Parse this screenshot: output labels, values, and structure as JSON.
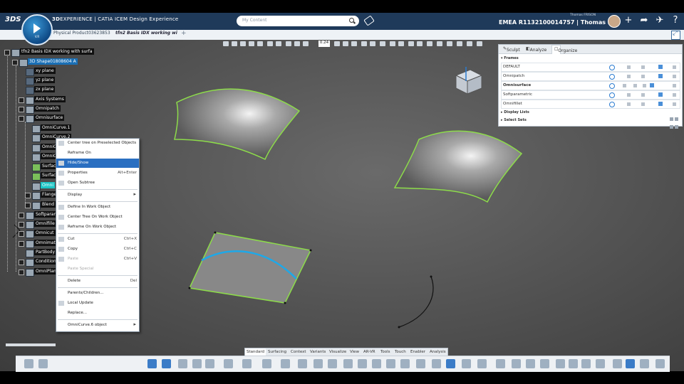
{
  "topbar": {
    "brand_bold": "3D",
    "brand_rest": "EXPERIENCE | CATIA",
    "brand_app": "ICEM Design Experience",
    "compass_label": "V.R",
    "search_placeholder": "My Content",
    "tenant": "EMEA R1132100014757 | Thomas ...",
    "user_name": "Thomas FRISON",
    "icons": [
      "ds-logo-icon",
      "search-icon",
      "tag-icon",
      "avatar",
      "plus-icon",
      "share-icon",
      "broadcast-icon",
      "help-icon"
    ]
  },
  "tabs": [
    {
      "label": "Physical Product03623853",
      "active": false
    },
    {
      "label": "tfn2 Basis IDX working wi",
      "active": true
    }
  ],
  "tree": {
    "items": [
      {
        "label": "tfn2 Basis IDX working with surfa",
        "style": "plain"
      },
      {
        "label": "3D Shape01808604 A",
        "style": "sel"
      },
      {
        "label": "xy plane",
        "style": "plain"
      },
      {
        "label": "yz plane",
        "style": "plain"
      },
      {
        "label": "zx plane",
        "style": "plain"
      },
      {
        "label": "Axis Systems",
        "style": "plain"
      },
      {
        "label": "Omnipatch",
        "style": "plain"
      },
      {
        "label": "Omnisurface",
        "style": "plain"
      },
      {
        "label": "OmniCurve.1",
        "style": "plain"
      },
      {
        "label": "OmniCurve.2",
        "style": "plain"
      },
      {
        "label": "OmniCurve.1",
        "style": "plain"
      },
      {
        "label": "OmniCurve.2",
        "style": "plain"
      },
      {
        "label": "Surface.13",
        "style": "plain"
      },
      {
        "label": "Surface.13",
        "style": "plain"
      },
      {
        "label": "Omni",
        "style": "hl"
      },
      {
        "label": "Flange",
        "style": "plain"
      },
      {
        "label": "Blend",
        "style": "plain"
      },
      {
        "label": "Softparam",
        "style": "plain"
      },
      {
        "label": "Omnifille",
        "style": "plain"
      },
      {
        "label": "Omnicut",
        "style": "plain"
      },
      {
        "label": "Omnimat",
        "style": "plain"
      },
      {
        "label": "PartBody",
        "style": "plain"
      },
      {
        "label": "Condition",
        "style": "plain"
      },
      {
        "label": "OmniPlan",
        "style": "plain"
      }
    ]
  },
  "view_toolbar": {
    "zoom_value": "0.24"
  },
  "frames_panel": {
    "tabs": [
      "Sculpt",
      "Analyze",
      "Organize"
    ],
    "active_tab": "Organize",
    "section_frames": "Frames",
    "section_display_lists": "Display Lists",
    "section_select_sets": "Select Sets",
    "rows": [
      {
        "name": "DEFAULT",
        "bold": false
      },
      {
        "name": "Omnipatch",
        "bold": false
      },
      {
        "name": "Omnisurface",
        "bold": true
      },
      {
        "name": "Softparametric",
        "bold": false
      },
      {
        "name": "Omnifillet",
        "bold": false
      }
    ]
  },
  "context_menu": {
    "items": [
      {
        "label": "Center tree on Preselected Objects",
        "shortcut": ""
      },
      {
        "label": "Reframe On",
        "shortcut": ""
      },
      {
        "label": "Hide/Show",
        "shortcut": "",
        "state": "hot"
      },
      {
        "label": "Properties",
        "shortcut": "Alt+Enter"
      },
      {
        "label": "Open Subtree",
        "shortcut": ""
      },
      {
        "label": "Display",
        "shortcut": "",
        "submenu": true
      },
      {
        "label": "Define In Work Object",
        "shortcut": ""
      },
      {
        "label": "Center Tree On Work Object",
        "shortcut": ""
      },
      {
        "label": "Reframe On Work Object",
        "shortcut": ""
      },
      {
        "label": "Cut",
        "shortcut": "Ctrl+X"
      },
      {
        "label": "Copy",
        "shortcut": "Ctrl+C"
      },
      {
        "label": "Paste",
        "shortcut": "Ctrl+V",
        "state": "disabled"
      },
      {
        "label": "Paste Special",
        "shortcut": "",
        "state": "disabled"
      },
      {
        "label": "Delete",
        "shortcut": "Del"
      },
      {
        "label": "Parents/Children...",
        "shortcut": ""
      },
      {
        "label": "Local Update",
        "shortcut": ""
      },
      {
        "label": "Replace...",
        "shortcut": ""
      },
      {
        "label": "OmniCurve.6 object",
        "shortcut": "",
        "submenu": true
      }
    ]
  },
  "app_tabs": [
    {
      "label": "Standard",
      "active": true
    },
    {
      "label": "Surfacing",
      "active": false
    },
    {
      "label": "Context",
      "active": false
    },
    {
      "label": "Variants",
      "active": false
    },
    {
      "label": "Visualize",
      "active": false
    },
    {
      "label": "View",
      "active": false
    },
    {
      "label": "AR-VR",
      "active": false
    },
    {
      "label": "Tools",
      "active": false
    },
    {
      "label": "Touch",
      "active": false
    },
    {
      "label": "Enabler",
      "active": false
    },
    {
      "label": "Analysis",
      "active": false
    }
  ],
  "colors": {
    "topbar": "#1f3a5a",
    "selection": "#1a6fb5",
    "highlight": "#1cc6c6",
    "surface_edge": "#8ddc4a",
    "curve": "#1ea8e8",
    "menu_hot": "#2a6fc1"
  }
}
